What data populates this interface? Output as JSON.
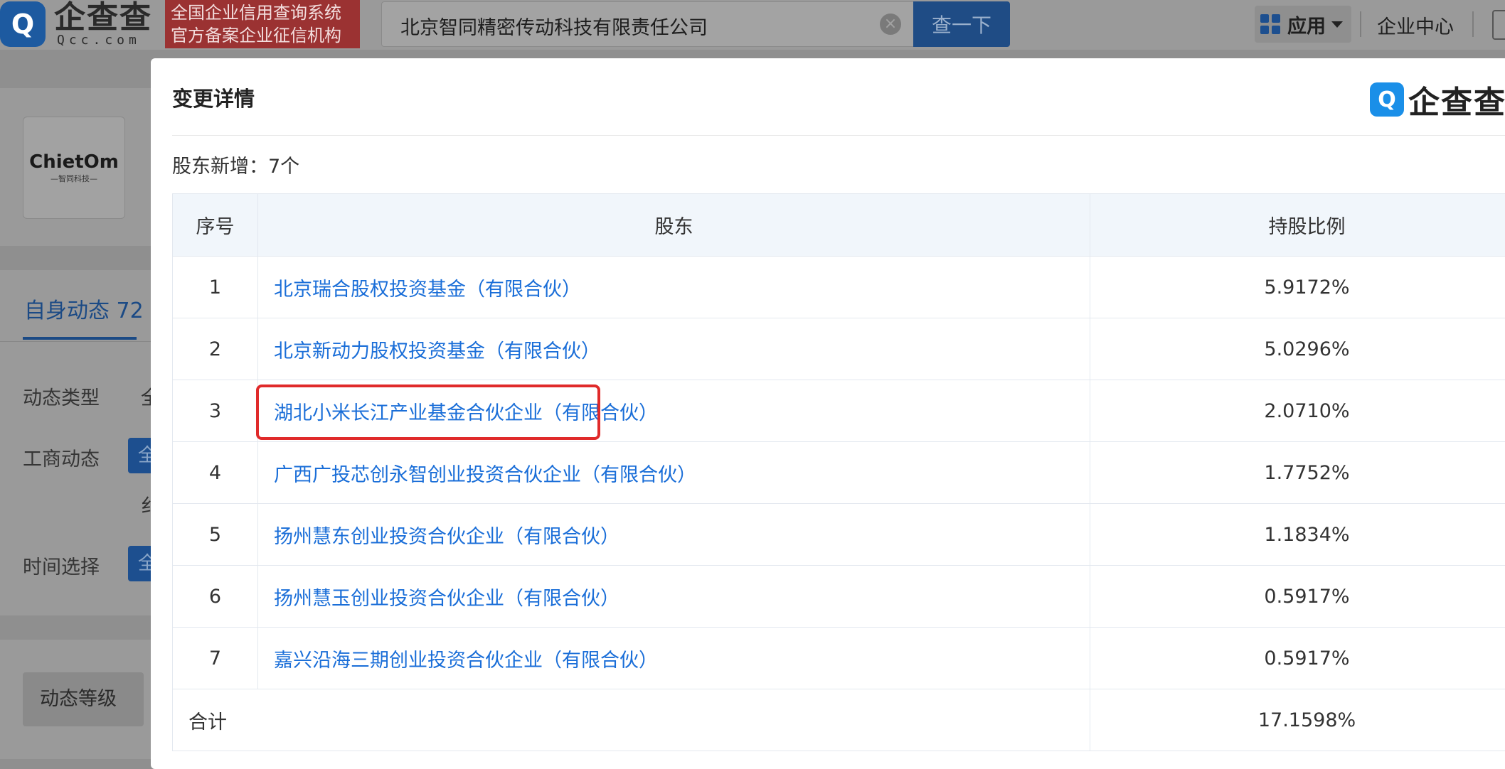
{
  "header": {
    "logo_mark": "Q",
    "logo_text": "企查查",
    "logo_url": "Qcc.com",
    "tagline_line1": "全国企业信用查询系统",
    "tagline_line2": "官方备案企业征信机构",
    "search_value": "北京智同精密传动科技有限责任公司",
    "search_button": "查一下",
    "app_label": "应用",
    "enterprise_center": "企业中心"
  },
  "background": {
    "company_logo_name": "ChietOm",
    "company_logo_sub": "—智同科技—",
    "tab_self_dynamics": "自身动态 72",
    "filter_type_label": "动态类型",
    "filter_type_cut": "全",
    "filter_business_label": "工商动态",
    "filter_business_pill": "全",
    "filter_business_cut2": "纟",
    "filter_time_label": "时间选择",
    "filter_time_pill": "全",
    "level_label": "动态等级"
  },
  "modal": {
    "title": "变更详情",
    "brand_mark": "Q",
    "brand_text": "企查查",
    "summary": "股东新增：7个",
    "columns": {
      "index": "序号",
      "shareholder": "股东",
      "ratio": "持股比例"
    },
    "rows": [
      {
        "index": "1",
        "name": "北京瑞合股权投资基金（有限合伙）",
        "ratio": "5.9172%"
      },
      {
        "index": "2",
        "name": "北京新动力股权投资基金（有限合伙）",
        "ratio": "5.0296%"
      },
      {
        "index": "3",
        "name": "湖北小米长江产业基金合伙企业（有限合伙）",
        "ratio": "2.0710%"
      },
      {
        "index": "4",
        "name": "广西广投芯创永智创业投资合伙企业（有限合伙）",
        "ratio": "1.7752%"
      },
      {
        "index": "5",
        "name": "扬州慧东创业投资合伙企业（有限合伙）",
        "ratio": "1.1834%"
      },
      {
        "index": "6",
        "name": "扬州慧玉创业投资合伙企业（有限合伙）",
        "ratio": "0.5917%"
      },
      {
        "index": "7",
        "name": "嘉兴沿海三期创业投资合伙企业（有限合伙）",
        "ratio": "0.5917%"
      }
    ],
    "total_label": "合计",
    "total_ratio": "17.1598%",
    "highlighted_row": "3",
    "highlight_color": "#e02a2a",
    "link_color": "#1a6ed8"
  }
}
